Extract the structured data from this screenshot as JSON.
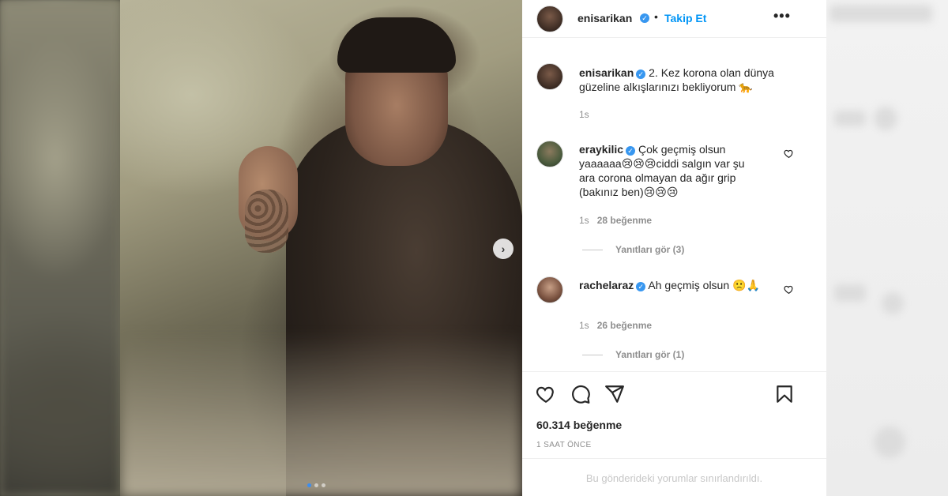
{
  "post": {
    "username": "enisarikan",
    "follow_label": "Takip Et",
    "more_label": "•••",
    "separator": "•",
    "caption": "2. Kez korona olan dünya güzeline alkışlarınızı bekliyorum 🐆",
    "caption_time": "1s",
    "likes": "60.314 beğenme",
    "posted_time": "1 SAAT ÖNCE",
    "restricted_notice": "Bu gönderideki yorumlar sınırlandırıldı."
  },
  "comments": [
    {
      "username": "eraykilic",
      "text": "Çok geçmiş olsun yaaaaaa😢😢😢ciddi salgın var şu ara corona olmayan da ağır grip (bakınız ben)😢😢😢",
      "time": "1s",
      "likes": "28 beğenme",
      "replies": "Yanıtları gör (3)"
    },
    {
      "username": "rachelaraz",
      "text": "Ah geçmiş olsun 🙁🙏",
      "time": "1s",
      "likes": "26 beğenme",
      "replies": "Yanıtları gör (1)"
    }
  ],
  "icons": {
    "verified": "verified-badge-icon",
    "heart": "heart-icon",
    "comment": "comment-icon",
    "share": "share-icon",
    "save": "bookmark-icon",
    "next": "chevron-right-icon"
  },
  "colors": {
    "link": "#0095f6",
    "verified": "#3897f0",
    "muted": "#8e8e8e"
  },
  "carousel": {
    "slides": 3,
    "active_index": 0
  }
}
